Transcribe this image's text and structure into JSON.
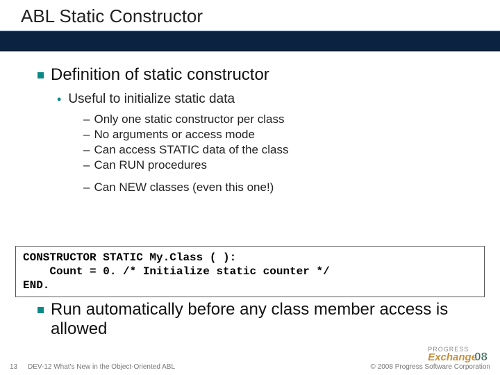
{
  "title": "ABL Static Constructor",
  "section1": {
    "heading": "Definition of static constructor",
    "sub": "Useful to initialize static data",
    "points": {
      "p1": "Only one static constructor per class",
      "p2": "No arguments or access mode",
      "p3": "Can access STATIC data of the class",
      "p4": "Can RUN procedures",
      "p5": "Can NEW classes (even this one!)"
    }
  },
  "code": "CONSTRUCTOR STATIC My.Class ( ):\n    Count = 0. /* Initialize static counter */\nEND.",
  "section2": {
    "heading": "Run automatically before any class member access is allowed"
  },
  "footer": {
    "page": "13",
    "title": "DEV-12 What's New in the Object-Oriented ABL",
    "copyright": "© 2008 Progress Software Corporation",
    "logo_top": "PROGRESS",
    "logo_main": "Exchange",
    "logo_year": "08"
  }
}
